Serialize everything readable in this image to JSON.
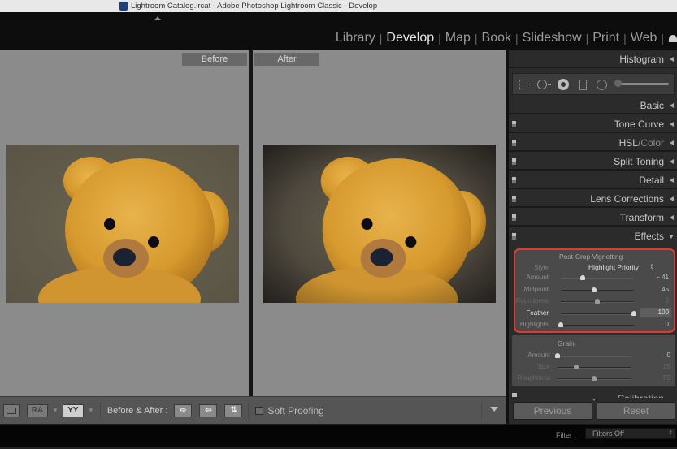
{
  "window": {
    "title": "Lightroom Catalog.lrcat - Adobe Photoshop Lightroom Classic - Develop",
    "app_icon": "lightroom-icon"
  },
  "modules": {
    "items": [
      {
        "label": "Library",
        "active": false
      },
      {
        "label": "Develop",
        "active": true
      },
      {
        "label": "Map",
        "active": false
      },
      {
        "label": "Book",
        "active": false
      },
      {
        "label": "Slideshow",
        "active": false
      },
      {
        "label": "Print",
        "active": false
      },
      {
        "label": "Web",
        "active": false
      }
    ],
    "separator": "|"
  },
  "viewer": {
    "before_label": "Before",
    "after_label": "After",
    "photo_subject": "teddy bear"
  },
  "toolbar": {
    "loupe_icon": "loupe-view-icon",
    "ra_label": "RA",
    "yy_label": "YY",
    "before_after_label": "Before & After :",
    "copy_before_to_after_icon": "arrow-right-icon",
    "copy_after_to_before_icon": "arrow-left-icon",
    "swap_icon": "swap-icon",
    "soft_proofing_label": "Soft Proofing",
    "soft_proofing_checked": false
  },
  "right_panel": {
    "histogram": "Histogram",
    "basic": "Basic",
    "tone_curve": "Tone Curve",
    "hsl": "HSL",
    "hsl_sep": " / ",
    "color": "Color",
    "split_toning": "Split Toning",
    "detail": "Detail",
    "lens_corrections": "Lens Corrections",
    "transform": "Transform",
    "effects": "Effects",
    "calibration": "Calibration",
    "tools": [
      "crop-overlay-icon",
      "spot-removal-icon",
      "red-eye-icon",
      "graduated-filter-icon",
      "radial-filter-icon",
      "adjustment-brush-icon"
    ],
    "vignetting": {
      "title": "Post-Crop Vignetting",
      "style_label": "Style",
      "style_value": "Highlight Priority",
      "sliders": [
        {
          "label": "Amount",
          "value": "− 41",
          "position": 0.295,
          "emph": false,
          "muted": false
        },
        {
          "label": "Midpoint",
          "value": "45",
          "position": 0.45,
          "emph": false,
          "muted": false
        },
        {
          "label": "Roundness",
          "value": "0",
          "position": 0.5,
          "emph": false,
          "muted": true
        },
        {
          "label": "Feather",
          "value": "100",
          "position": 1.0,
          "emph": true,
          "muted": false
        },
        {
          "label": "Highlights",
          "value": "0",
          "position": 0.0,
          "emph": false,
          "muted": false
        }
      ]
    },
    "grain": {
      "title": "Grain",
      "sliders": [
        {
          "label": "Amount",
          "value": "0",
          "position": 0.0,
          "emph": false,
          "muted": false
        },
        {
          "label": "Size",
          "value": "25",
          "position": 0.25,
          "emph": false,
          "muted": true
        },
        {
          "label": "Roughness",
          "value": "50",
          "position": 0.5,
          "emph": false,
          "muted": true
        }
      ]
    },
    "previous_label": "Previous",
    "reset_label": "Reset"
  },
  "filmstrip": {
    "filter_label": "Filter :",
    "filter_value": "Filters Off"
  },
  "colors": {
    "highlight_box": "#e03b2e",
    "panel_bg": "#2b2b2b",
    "viewer_bg": "#8b8b8b"
  }
}
